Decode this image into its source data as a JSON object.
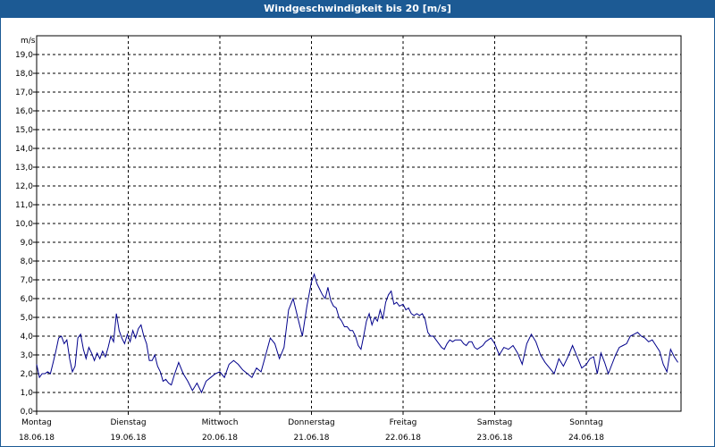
{
  "window": {
    "title": "Windgeschwindigkeit bis 20 [m/s]"
  },
  "colors": {
    "titlebar": "#1c5a94",
    "series": "#00008b",
    "grid": "#000000"
  },
  "chart_data": {
    "type": "line",
    "title": "Windgeschwindigkeit bis 20 [m/s]",
    "ylabel": "m/s",
    "xlabel": "",
    "ylim": [
      0,
      20
    ],
    "yticks": [
      "0,0",
      "1,0",
      "2,0",
      "3,0",
      "4,0",
      "5,0",
      "6,0",
      "7,0",
      "8,0",
      "9,0",
      "10,0",
      "11,0",
      "12,0",
      "13,0",
      "14,0",
      "15,0",
      "16,0",
      "17,0",
      "18,0",
      "19,0"
    ],
    "grid": "dashed",
    "day_labels": [
      {
        "day": "Montag",
        "date": "18.06.18"
      },
      {
        "day": "Dienstag",
        "date": "19.06.18"
      },
      {
        "day": "Mittwoch",
        "date": "20.06.18"
      },
      {
        "day": "Donnerstag",
        "date": "21.06.18"
      },
      {
        "day": "Freitag",
        "date": "22.06.18"
      },
      {
        "day": "Samstag",
        "date": "23.06.18"
      },
      {
        "day": "Sonntag",
        "date": "24.06.18"
      }
    ],
    "x_range_days": [
      0,
      7
    ],
    "series": [
      {
        "x": [
          0,
          0.03,
          0.06,
          0.09,
          0.12,
          0.15,
          0.18,
          0.21,
          0.24,
          0.27,
          0.3,
          0.33,
          0.36,
          0.39,
          0.42,
          0.45,
          0.48,
          0.51,
          0.54,
          0.57,
          0.6,
          0.63,
          0.66,
          0.69,
          0.72,
          0.75,
          0.78,
          0.81,
          0.84,
          0.87,
          0.9,
          0.93,
          0.96,
          0.99,
          1.02,
          1.05,
          1.08,
          1.11,
          1.14,
          1.17,
          1.2,
          1.23,
          1.26,
          1.29,
          1.32,
          1.35,
          1.38,
          1.41,
          1.44,
          1.47,
          1.5,
          1.55,
          1.6,
          1.65,
          1.7,
          1.75,
          1.8,
          1.85,
          1.9,
          1.95,
          2.0,
          2.05,
          2.1,
          2.15,
          2.2,
          2.25,
          2.3,
          2.35,
          2.4,
          2.45,
          2.5,
          2.55,
          2.6,
          2.65,
          2.7,
          2.75,
          2.8,
          2.85,
          2.9,
          2.95,
          3.0,
          3.03,
          3.06,
          3.09,
          3.12,
          3.15,
          3.18,
          3.21,
          3.24,
          3.27,
          3.3,
          3.33,
          3.36,
          3.39,
          3.42,
          3.45,
          3.48,
          3.51,
          3.54,
          3.57,
          3.6,
          3.63,
          3.66,
          3.69,
          3.72,
          3.75,
          3.78,
          3.81,
          3.84,
          3.87,
          3.9,
          3.93,
          3.96,
          4.0,
          4.03,
          4.06,
          4.09,
          4.12,
          4.15,
          4.18,
          4.21,
          4.24,
          4.27,
          4.3,
          4.33,
          4.36,
          4.39,
          4.42,
          4.45,
          4.48,
          4.51,
          4.54,
          4.57,
          4.6,
          4.63,
          4.66,
          4.69,
          4.72,
          4.75,
          4.78,
          4.81,
          4.84,
          4.87,
          4.9,
          4.93,
          4.96,
          5.0,
          5.05,
          5.1,
          5.15,
          5.2,
          5.25,
          5.3,
          5.35,
          5.4,
          5.45,
          5.5,
          5.55,
          5.6,
          5.65,
          5.7,
          5.75,
          5.8,
          5.85,
          5.9,
          5.95,
          6.0,
          6.04,
          6.08,
          6.12,
          6.16,
          6.2,
          6.24,
          6.28,
          6.32,
          6.36,
          6.4,
          6.44,
          6.48,
          6.52,
          6.56,
          6.6,
          6.64,
          6.68,
          6.72,
          6.76,
          6.8,
          6.84,
          6.88,
          6.92,
          6.96,
          7.0
        ],
        "values": [
          2.5,
          1.8,
          2.0,
          2.0,
          2.1,
          2.0,
          2.6,
          3.2,
          3.9,
          4.0,
          3.6,
          3.8,
          2.8,
          2.1,
          2.4,
          3.9,
          4.1,
          3.3,
          2.8,
          3.4,
          3.1,
          2.7,
          3.1,
          2.8,
          3.2,
          2.9,
          3.4,
          4.0,
          3.7,
          5.2,
          4.3,
          3.9,
          3.6,
          4.1,
          3.7,
          4.3,
          3.9,
          4.4,
          4.6,
          4.0,
          3.6,
          2.7,
          2.7,
          3.0,
          2.4,
          2.1,
          1.6,
          1.7,
          1.5,
          1.4,
          1.9,
          2.6,
          2.0,
          1.6,
          1.1,
          1.5,
          1.0,
          1.6,
          1.8,
          2.0,
          2.1,
          1.8,
          2.5,
          2.7,
          2.5,
          2.2,
          2.0,
          1.8,
          2.3,
          2.1,
          3.0,
          3.9,
          3.6,
          2.8,
          3.4,
          5.4,
          6.0,
          5.0,
          4.0,
          5.6,
          6.9,
          7.3,
          6.8,
          6.5,
          6.2,
          6.0,
          6.6,
          5.9,
          5.6,
          5.5,
          5.0,
          4.8,
          4.5,
          4.5,
          4.3,
          4.3,
          4.0,
          3.5,
          3.3,
          4.0,
          4.8,
          5.2,
          4.6,
          5.0,
          4.8,
          5.4,
          4.9,
          5.8,
          6.2,
          6.4,
          5.7,
          5.8,
          5.6,
          5.7,
          5.4,
          5.5,
          5.2,
          5.1,
          5.2,
          5.1,
          5.2,
          4.9,
          4.2,
          4.0,
          4.0,
          3.8,
          3.6,
          3.4,
          3.3,
          3.6,
          3.8,
          3.7,
          3.8,
          3.8,
          3.8,
          3.6,
          3.5,
          3.7,
          3.7,
          3.4,
          3.3,
          3.4,
          3.5,
          3.7,
          3.8,
          3.9,
          3.6,
          3.0,
          3.4,
          3.3,
          3.5,
          3.1,
          2.5,
          3.6,
          4.1,
          3.7,
          3.0,
          2.6,
          2.3,
          2.0,
          2.8,
          2.4,
          2.9,
          3.5,
          2.9,
          2.3,
          2.5,
          2.8,
          2.9,
          2.0,
          3.1,
          2.6,
          2.0,
          2.5,
          3.0,
          3.4,
          3.5,
          3.6,
          4.0,
          4.1,
          4.2,
          4.0,
          3.9,
          3.7,
          3.8,
          3.5,
          3.2,
          2.5,
          2.1,
          3.3,
          2.9,
          2.6
        ]
      }
    ]
  }
}
